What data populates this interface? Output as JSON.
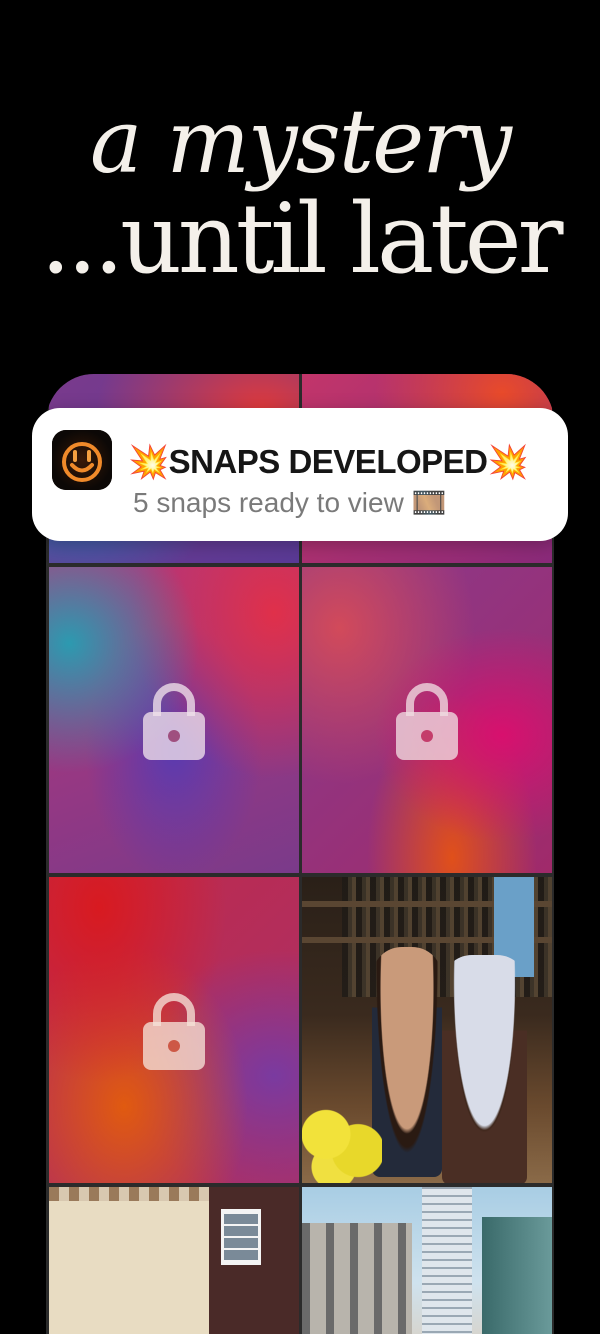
{
  "headline": {
    "line1": "a mystery",
    "line2": "...until later"
  },
  "notification": {
    "app_icon": "smiley-face-icon",
    "title": "💥SNAPS DEVELOPED💥",
    "body": "5 snaps ready to view 🎞️"
  },
  "grid": {
    "tiles": [
      {
        "type": "locked",
        "icon": "lock-icon"
      },
      {
        "type": "locked",
        "icon": "lock-icon"
      },
      {
        "type": "locked",
        "icon": "lock-icon"
      },
      {
        "type": "locked",
        "icon": "lock-icon"
      },
      {
        "type": "locked",
        "icon": "lock-icon"
      },
      {
        "type": "photo"
      },
      {
        "type": "photo"
      },
      {
        "type": "photo"
      }
    ]
  },
  "colors": {
    "background": "#000000",
    "headline_text": "#f4f0ea",
    "notification_bg": "#ffffff",
    "notification_title": "#161616",
    "notification_body": "#7a7a7a",
    "app_icon_accent": "#f08a2a"
  }
}
